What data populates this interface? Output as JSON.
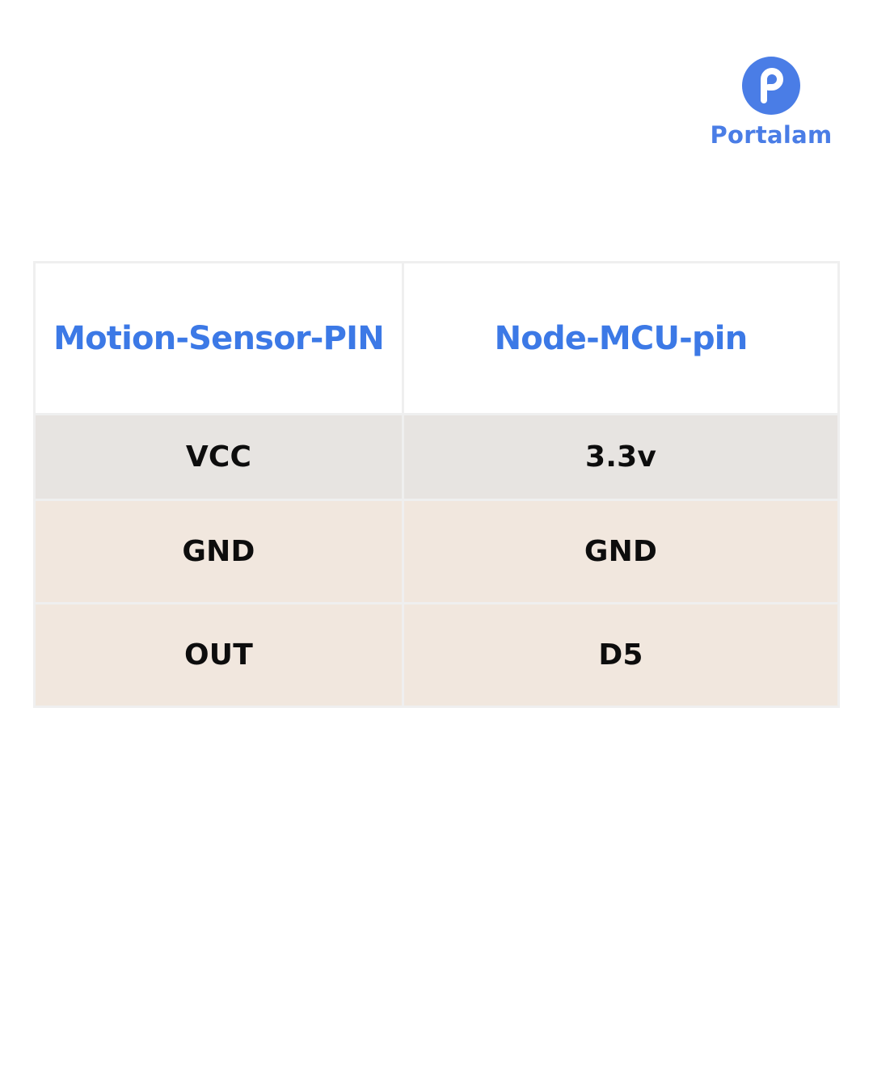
{
  "brand": {
    "name": "Portalam",
    "logo_icon": "p-logo-icon",
    "color": "#4a7de6"
  },
  "table": {
    "headers": [
      "Motion-Sensor-PIN",
      "Node-MCU-pin"
    ],
    "rows": [
      [
        "VCC",
        "3.3v"
      ],
      [
        "GND",
        "GND"
      ],
      [
        "OUT",
        "D5"
      ]
    ],
    "colors": {
      "header_text": "#3c79e6",
      "header_bg": "#ffffff",
      "first_row_bg": "#e7e4e1",
      "other_rows_bg": "#f1e7de",
      "cell_text": "#0d0d0d",
      "border": "#efefef"
    }
  }
}
